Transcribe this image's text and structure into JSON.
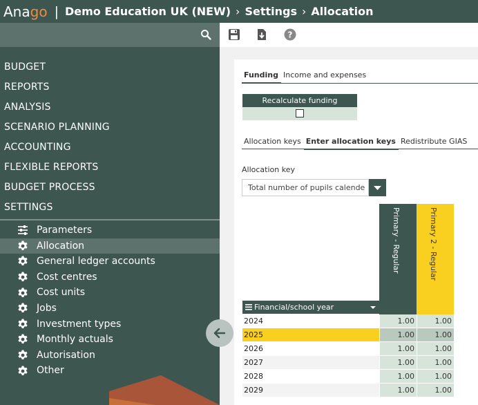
{
  "header": {
    "logo_main": "Ana",
    "logo_accent": "go",
    "separator": "|",
    "breadcrumb": [
      "Demo Education UK (NEW)",
      "Settings",
      "Allocation"
    ],
    "crumb_arrow": "›"
  },
  "sidebar": {
    "menu": [
      "BUDGET",
      "REPORTS",
      "ANALYSIS",
      "SCENARIO PLANNING",
      "ACCOUNTING",
      "FLEXIBLE REPORTS",
      "BUDGET PROCESS",
      "SETTINGS"
    ],
    "submenu": [
      {
        "label": "Parameters",
        "icon": "sliders-icon"
      },
      {
        "label": "Allocation",
        "icon": "gear-icon"
      },
      {
        "label": "General ledger accounts",
        "icon": "gear-icon"
      },
      {
        "label": "Cost centres",
        "icon": "gear-icon"
      },
      {
        "label": "Cost units",
        "icon": "gear-icon"
      },
      {
        "label": "Jobs",
        "icon": "gear-icon"
      },
      {
        "label": "Investment types",
        "icon": "gear-icon"
      },
      {
        "label": "Monthly actuals",
        "icon": "gear-icon"
      },
      {
        "label": "Autorisation",
        "icon": "gear-icon"
      },
      {
        "label": "Other",
        "icon": "gear-icon"
      }
    ],
    "active_index": 1
  },
  "toolbar": {
    "icons": [
      "save-icon",
      "download-icon",
      "help-icon"
    ]
  },
  "main": {
    "tabs_top": [
      "Funding",
      "Income and expenses"
    ],
    "recalc_label": "Recalculate funding",
    "tabs_alloc": [
      "Allocation keys",
      "Enter allocation keys",
      "Redistribute GIAS"
    ],
    "alloc_key_label": "Allocation key",
    "alloc_key_value": "Total number of pupils calende",
    "columns": [
      "Primary - Regular",
      "Primary 2 - Regular"
    ],
    "row_header": "Financial/school year",
    "rows": [
      {
        "year": "2024",
        "values": [
          "1.00",
          "1.00"
        ]
      },
      {
        "year": "2025",
        "values": [
          "1.00",
          "1.00"
        ]
      },
      {
        "year": "2026",
        "values": [
          "1.00",
          "1.00"
        ]
      },
      {
        "year": "2027",
        "values": [
          "1.00",
          "1.00"
        ]
      },
      {
        "year": "2028",
        "values": [
          "1.00",
          "1.00"
        ]
      },
      {
        "year": "2029",
        "values": [
          "1.00",
          "1.00"
        ]
      }
    ],
    "highlight_row": 1
  },
  "colors": {
    "primary": "#3e5650",
    "sidebar_active": "#5d726d",
    "accent_yellow": "#f9cf20",
    "logo_orange": "#f08a3c",
    "cell_green": "#d6e4d9"
  }
}
